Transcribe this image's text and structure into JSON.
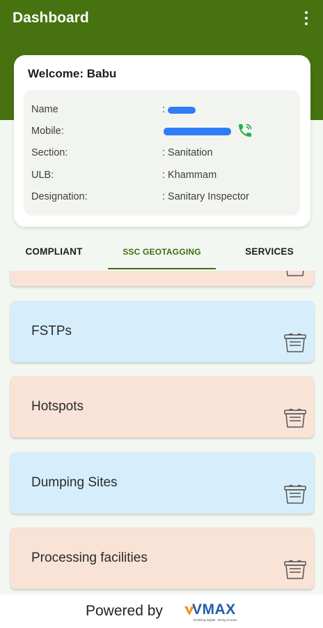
{
  "header": {
    "title": "Dashboard",
    "menu_icon": "more-vert-icon",
    "background_color": "#46720f"
  },
  "profile": {
    "welcome_text": "Welcome: Babu",
    "rows": [
      {
        "label": "Name",
        "value": ":"
      },
      {
        "label": "Mobile:",
        "value": ""
      },
      {
        "label": "Section:",
        "value": ": Sanitation"
      },
      {
        "label": "ULB:",
        "value": ": Khammam"
      },
      {
        "label": "Designation:",
        "value": ": Sanitary Inspector"
      }
    ],
    "phone_icon": "phone-icon",
    "phone_icon_color": "#22b14c",
    "redaction_color": "#2f7df6"
  },
  "tabs": [
    {
      "label": "COMPLIANT",
      "active": false
    },
    {
      "label": "SSC GEOTAGGING",
      "active": true
    },
    {
      "label": "SERVICES",
      "active": false
    }
  ],
  "tab_accent_color": "#3f6e10",
  "items": [
    {
      "label": "",
      "color": "#f9e2d6",
      "icon": "dustbin-icon"
    },
    {
      "label": "FSTPs",
      "color": "#d6eefb",
      "icon": "dustbin-icon"
    },
    {
      "label": "Hotspots",
      "color": "#f9e2d6",
      "icon": "dustbin-icon"
    },
    {
      "label": "Dumping Sites",
      "color": "#d6eefb",
      "icon": "dustbin-icon"
    },
    {
      "label": "Processing facilities",
      "color": "#f9e2d6",
      "icon": "dustbin-icon"
    }
  ],
  "footer": {
    "powered_by": "Powered by",
    "logo_text": "VMAX",
    "logo_tagline": "Enabling Digital · Being Human",
    "logo_color": "#1f5fa8"
  }
}
